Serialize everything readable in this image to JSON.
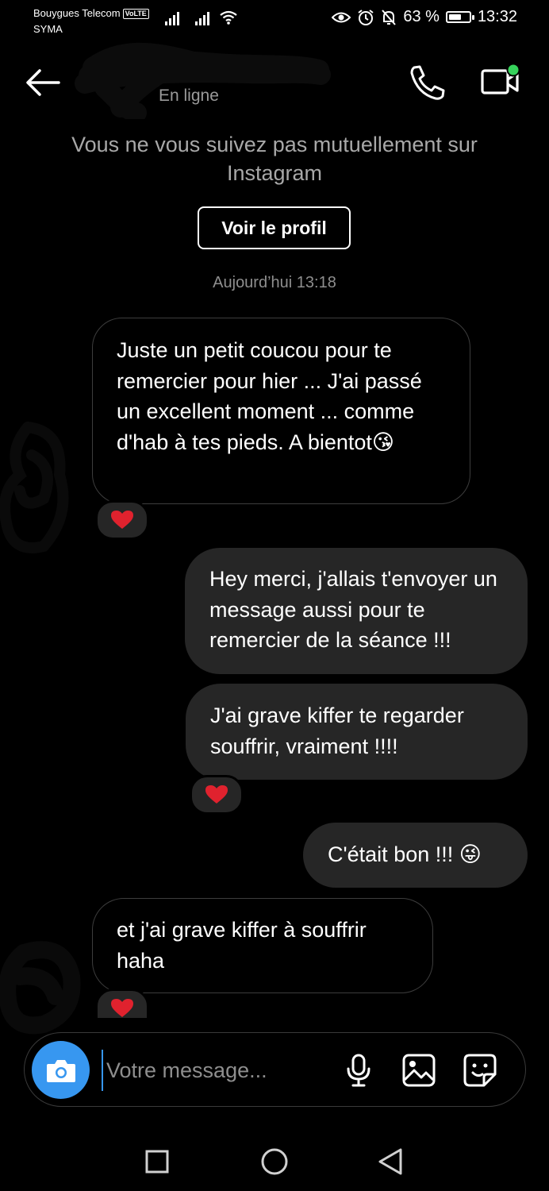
{
  "status_bar": {
    "carrier": "Bouygues Telecom",
    "volte": "VoLTE",
    "carrier2": "SYMA",
    "battery_text": "63 %",
    "battery_level": 0.63,
    "time": "13:32"
  },
  "header": {
    "status": "En ligne",
    "online_color": "#36d35b"
  },
  "notice": {
    "text": "Vous ne vous suivez pas mutuellement sur Instagram",
    "button": "Voir le profil"
  },
  "timestamp": "Aujourd’hui 13:18",
  "messages": [
    {
      "dir": "in",
      "text": "Juste un petit coucou pour te remercier pour hier ... J'ai passé un excellent moment ... comme d'hab à tes pieds. A bientot😘",
      "reaction": "❤️"
    },
    {
      "dir": "out",
      "text": "Hey merci, j'allais t'envoyer un message aussi pour te remercier de la séance !!!"
    },
    {
      "dir": "out",
      "text": "J'ai grave kiffer te regarder souffrir, vraiment !!!!",
      "reaction": "❤️"
    },
    {
      "dir": "out",
      "text": "C'était bon !!! 😜"
    },
    {
      "dir": "in",
      "text": "et j'ai grave kiffer à souffrir haha",
      "reaction": "❤️"
    }
  ],
  "composer": {
    "placeholder": "Votre message...",
    "accent": "#3797f0"
  },
  "colors": {
    "background": "#000000",
    "outgoing_bubble": "#262626",
    "heart": "#e0222e"
  }
}
